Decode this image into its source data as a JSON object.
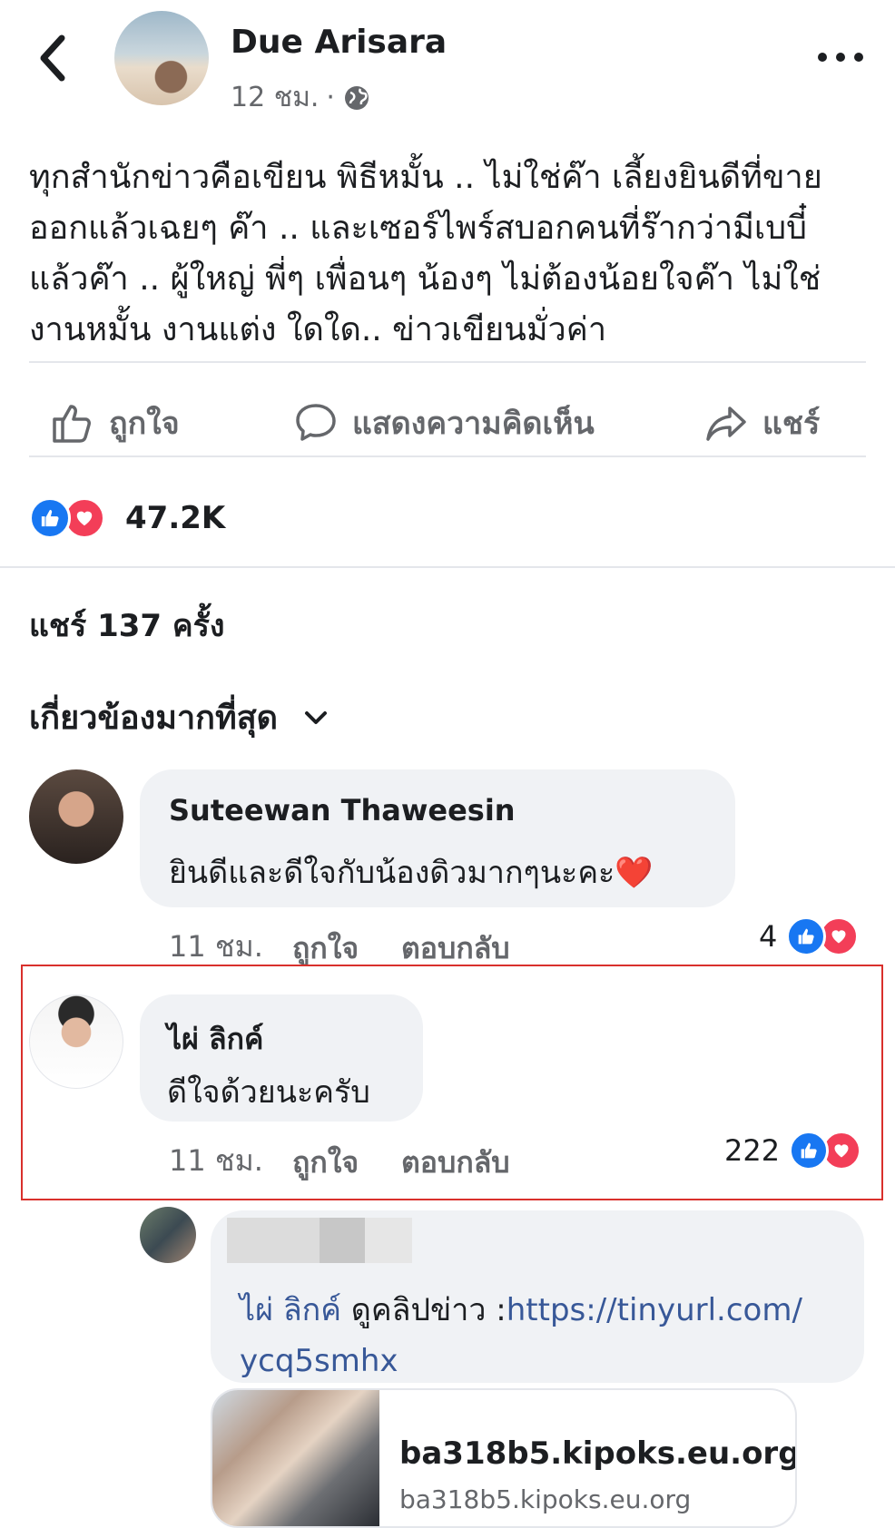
{
  "post": {
    "author": "Due Arisara",
    "time": "12 ชม.",
    "separator": "·",
    "text": "ทุกสำนักข่าวคือเขียน พิธีหมั้น .. ไม่ใช่ค๊า เลี้ยงยินดีที่ขายออกแล้วเฉยๆ ค๊า .. และเซอร์ไพร์สบอกคนที่ร๊ากว่ามีเบบี๋แล้วค๊า .. ผู้ใหญ่ พี่ๆ เพื่อนๆ น้องๆ ไม่ต้องน้อยใจค๊า ไม่ใช่งานหมั้น งานแต่ง ใดใด.. ข่าวเขียนมั่วค่า"
  },
  "actions": {
    "like": "ถูกใจ",
    "comment": "แสดงความคิดเห็น",
    "share": "แชร์"
  },
  "reactions": {
    "count": "47.2K"
  },
  "shares": "แชร์ 137 ครั้ง",
  "sort_label": "เกี่ยวข้องมากที่สุด",
  "comments": [
    {
      "name": "Suteewan Thaweesin",
      "text": "ยินดีและดีใจกับน้องดิวมากๆนะคะ",
      "emoji": "❤️",
      "time": "11 ชม.",
      "like": "ถูกใจ",
      "reply": "ตอบกลับ",
      "reaction_count": "4"
    },
    {
      "name": "ไผ่ ลิกค์",
      "text": "ดีใจด้วยนะครับ",
      "time": "11 ชม.",
      "like": "ถูกใจ",
      "reply": "ตอบกลับ",
      "reaction_count": "222"
    }
  ],
  "reply": {
    "mention": "ไผ่ ลิกค์",
    "text": " ดูคลิปข่าว :",
    "url_line1": "https://tinyurl.com/",
    "url_line2": "ycq5smhx",
    "preview_title": "ba318b5.kipoks.eu.org",
    "preview_url": "ba318b5.kipoks.eu.org"
  },
  "colors": {
    "like_blue": "#1877f2",
    "love_red": "#f33e58",
    "link_blue": "#385898",
    "highlight_red": "#d9302c"
  },
  "icons": [
    "back-arrow-icon",
    "more-dots-icon",
    "globe-icon",
    "like-thumb-icon",
    "comment-bubble-icon",
    "share-arrow-icon",
    "chevron-down-icon"
  ]
}
